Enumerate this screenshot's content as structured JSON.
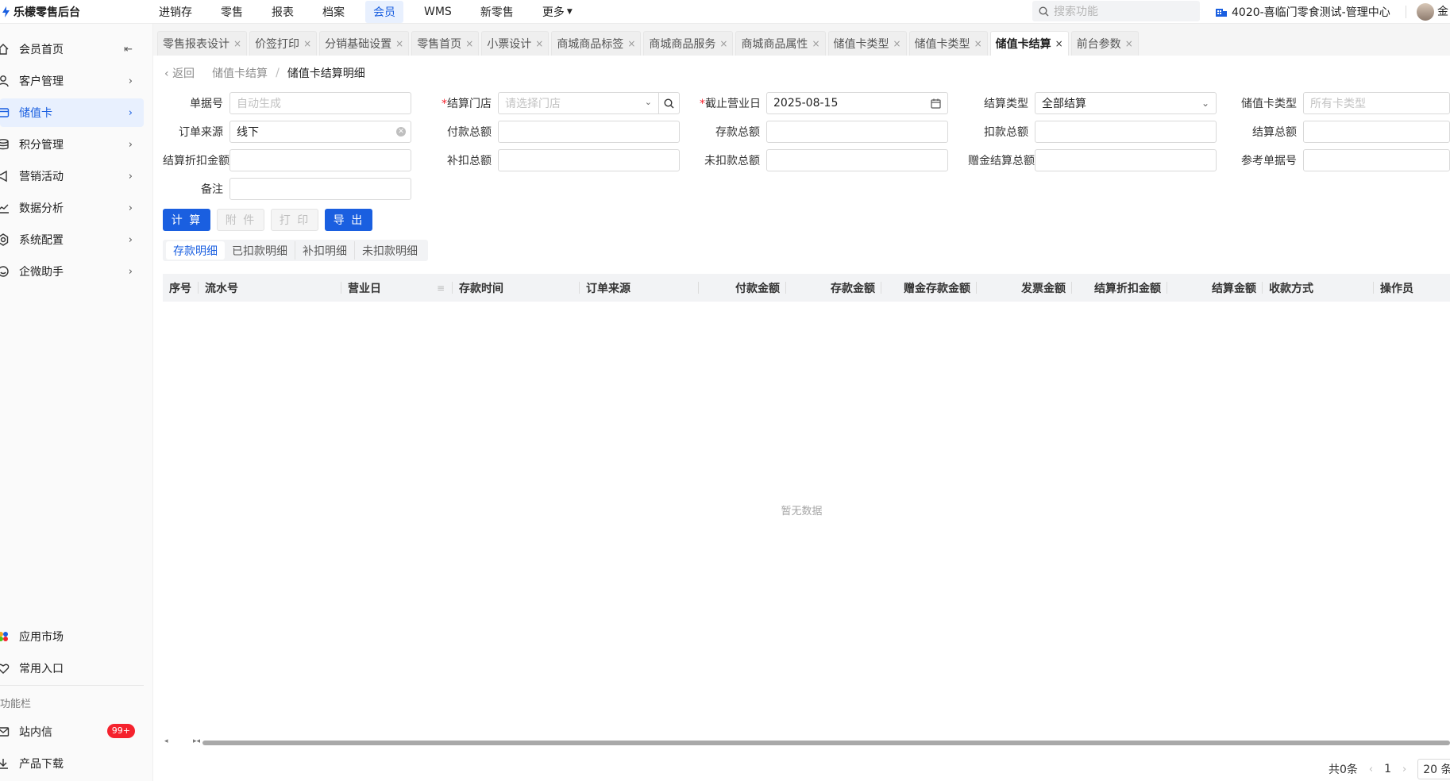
{
  "app": {
    "name": "乐檬零售后台"
  },
  "topnav": {
    "items": [
      {
        "label": "进销存",
        "active": false
      },
      {
        "label": "零售",
        "active": false
      },
      {
        "label": "报表",
        "active": false
      },
      {
        "label": "档案",
        "active": false
      },
      {
        "label": "会员",
        "active": true
      },
      {
        "label": "WMS",
        "active": false
      },
      {
        "label": "新零售",
        "active": false
      },
      {
        "label": "更多",
        "active": false
      }
    ],
    "search_placeholder": "搜索功能",
    "store": "4020-喜临门零食测试-管理中心",
    "user_initial": "金"
  },
  "sidebar": {
    "items": [
      {
        "label": "会员首页"
      },
      {
        "label": "客户管理"
      },
      {
        "label": "储值卡"
      },
      {
        "label": "积分管理"
      },
      {
        "label": "营销活动"
      },
      {
        "label": "数据分析"
      },
      {
        "label": "系统配置"
      },
      {
        "label": "企微助手"
      }
    ],
    "bottom": [
      {
        "label": "应用市场"
      },
      {
        "label": "常用入口"
      }
    ],
    "section_label": "功能栏",
    "utility": [
      {
        "label": "站内信",
        "badge": "99+"
      },
      {
        "label": "产品下载"
      }
    ]
  },
  "tabs": [
    {
      "label": "零售报表设计"
    },
    {
      "label": "价签打印"
    },
    {
      "label": "分销基础设置"
    },
    {
      "label": "零售首页"
    },
    {
      "label": "小票设计"
    },
    {
      "label": "商城商品标签"
    },
    {
      "label": "商城商品服务"
    },
    {
      "label": "商城商品属性"
    },
    {
      "label": "储值卡类型"
    },
    {
      "label": "储值卡类型"
    },
    {
      "label": "储值卡结算"
    },
    {
      "label": "前台参数"
    }
  ],
  "tab_close": "×",
  "breadcrumb": {
    "back": "返回",
    "parent": "储值卡结算",
    "current": "储值卡结算明细"
  },
  "form": {
    "doc_no": {
      "label": "单据号",
      "placeholder": "自动生成"
    },
    "store": {
      "label": "结算门店",
      "placeholder": "请选择门店"
    },
    "cutoff_date": {
      "label": "截止营业日",
      "value": "2025-08-15"
    },
    "settle_type": {
      "label": "结算类型",
      "value": "全部结算"
    },
    "card_type": {
      "label": "储值卡类型",
      "placeholder": "所有卡类型"
    },
    "order_source": {
      "label": "订单来源",
      "value": "线下"
    },
    "pay_total": {
      "label": "付款总额"
    },
    "deposit_total": {
      "label": "存款总额"
    },
    "deduct_total": {
      "label": "扣款总额"
    },
    "settle_total": {
      "label": "结算总额"
    },
    "settle_discount": {
      "label": "结算折扣金额"
    },
    "supplement_total": {
      "label": "补扣总额"
    },
    "undeducted_total": {
      "label": "未扣款总额"
    },
    "gift_settle_total": {
      "label": "赠金结算总额"
    },
    "ref_doc_no": {
      "label": "参考单据号"
    },
    "remark": {
      "label": "备注"
    }
  },
  "buttons": {
    "calc": "计 算",
    "attach": "附 件",
    "print": "打 印",
    "export": "导 出"
  },
  "subtabs": [
    {
      "label": "存款明细",
      "active": true
    },
    {
      "label": "已扣款明细",
      "active": false
    },
    {
      "label": "补扣明细",
      "active": false
    },
    {
      "label": "未扣款明细",
      "active": false
    }
  ],
  "table": {
    "columns": [
      "序号",
      "流水号",
      "营业日",
      "存款时间",
      "订单来源",
      "付款金额",
      "存款金额",
      "赠金存款金额",
      "发票金额",
      "结算折扣金额",
      "结算金额",
      "收款方式",
      "操作员"
    ],
    "empty_text": "暂无数据"
  },
  "pager": {
    "total": "共0条",
    "page": "1",
    "size": "20 条"
  }
}
